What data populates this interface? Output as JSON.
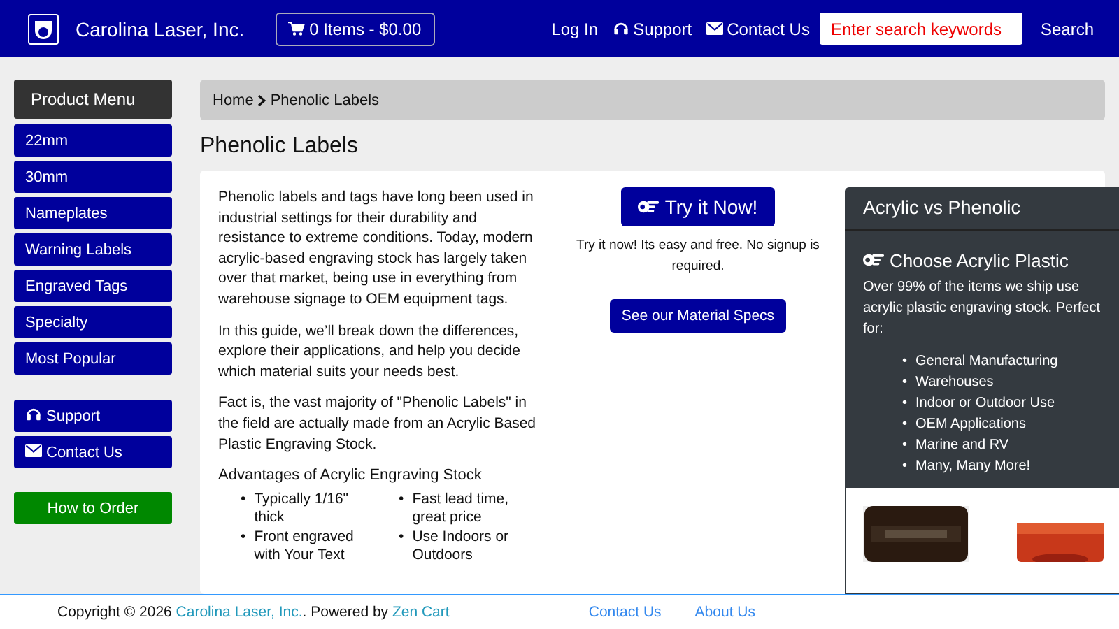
{
  "header": {
    "brand": "Carolina Laser, Inc.",
    "cart": "0 Items - $0.00",
    "links": [
      {
        "kind": "login",
        "label": "Log In"
      },
      {
        "kind": "support",
        "label": "Support"
      },
      {
        "kind": "contact",
        "label": "Contact Us"
      }
    ],
    "search": {
      "placeholder": "Enter search keywords",
      "button": "Search"
    }
  },
  "sidebar": {
    "title": "Product Menu",
    "items": [
      "22mm",
      "30mm",
      "Nameplates",
      "Warning Labels",
      "Engraved Tags",
      "Specialty",
      "Most Popular"
    ],
    "links": [
      {
        "kind": "support",
        "label": "Support"
      },
      {
        "kind": "contact",
        "label": "Contact Us"
      }
    ],
    "order_button": "How to Order"
  },
  "breadcrumb": [
    "Home",
    "Phenolic Labels"
  ],
  "title": "Phenolic Labels",
  "intro": [
    "Phenolic labels and tags have long been used in industrial settings for their durability and resistance to extreme conditions. Today, modern acrylic-based engraving stock has largely taken over that market, being use in everything from warehouse signage to OEM equipment tags.",
    "In this guide, we’ll break down the differences, explore their applications, and help you decide which material suits your needs best.",
    "Fact is, the vast majority of \"Phenolic Labels\" in the field are actually made from an Acrylic Based Plastic Engraving Stock."
  ],
  "advantages": {
    "title": "Advantages of Acrylic Engraving Stock",
    "bullet": "•",
    "items": [
      "Typically 1/16\" thick",
      "Fast lead time, great price",
      "Front engraved with Your Text",
      "Use Indoors or Outdoors"
    ]
  },
  "cta": {
    "button": "Try it Now!",
    "note": "Try it now! Its easy and free. No signup is required.",
    "specs_button": "See our Material Specs"
  },
  "panel": {
    "title": "Acrylic vs Phenolic",
    "heading": "Choose Acrylic Plastic",
    "text": "Over 99% of the items we ship use acrylic plastic engraving stock. Perfect for:",
    "bullet": "•",
    "items": [
      "General Manufacturing",
      "Warehouses",
      "Indoor or Outdoor Use",
      "OEM Applications",
      "Marine and RV",
      "Many, Many More!"
    ],
    "pictures": [
      {
        "kind": "picture"
      },
      {
        "kind": "picture"
      }
    ]
  },
  "footer": {
    "copyright": "Copyright © 2026 ",
    "company": "Carolina Laser, Inc.",
    "powered": ". Powered by ",
    "platform": "Zen Cart",
    "links": [
      "Contact Us",
      "About Us"
    ]
  }
}
